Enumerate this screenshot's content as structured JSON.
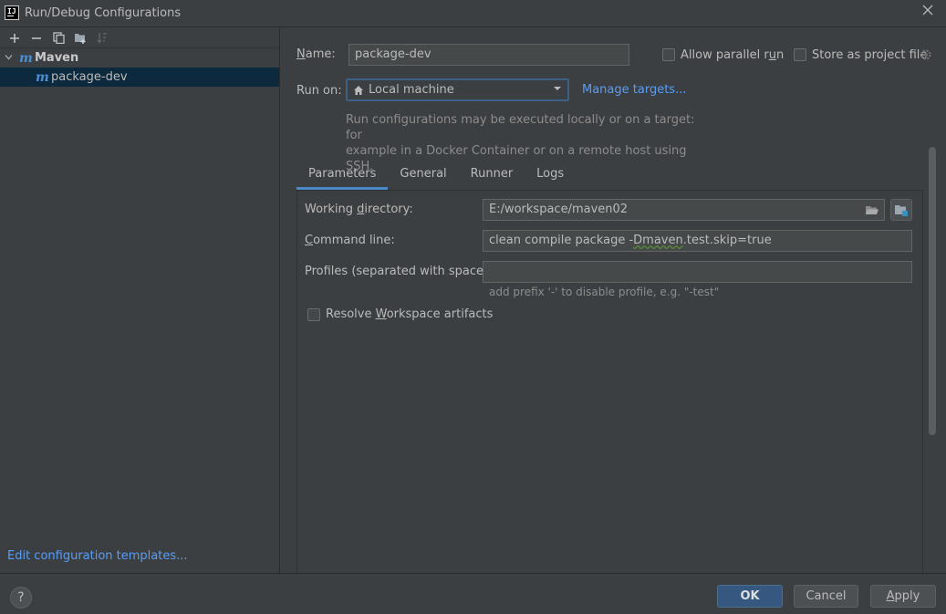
{
  "window": {
    "title": "Run/Debug Configurations",
    "app_icon_text": "IJ"
  },
  "toolbar": {
    "add": "+",
    "remove": "−"
  },
  "tree": {
    "group_label": "Maven",
    "group_icon": "m",
    "items": [
      {
        "label": "package-dev",
        "icon": "m"
      }
    ]
  },
  "left_footer": {
    "edit_templates": "Edit configuration templates..."
  },
  "config": {
    "name_label_u": "N",
    "name_label_rest": "ame:",
    "name_value": "package-dev",
    "allow_parallel_a": "Allow parallel r",
    "allow_parallel_u": "u",
    "allow_parallel_b": "n",
    "store_project_file": "Store as project file",
    "run_on_label": "Run on:",
    "run_on_value": "Local machine",
    "manage_targets": "Manage targets...",
    "run_on_desc_1": "Run configurations may be executed locally or on a target: for",
    "run_on_desc_2": "example in a Docker Container or on a remote host using SSH."
  },
  "tabs": [
    "Parameters",
    "General",
    "Runner",
    "Logs"
  ],
  "parameters": {
    "working_dir_a": "Working ",
    "working_dir_u": "d",
    "working_dir_b": "irectory:",
    "working_dir_value": "E:/workspace/maven02",
    "command_line_u": "C",
    "command_line_rest": "ommand line:",
    "command_line_a": "clean compile package -",
    "command_line_typo": "Dmaven",
    "command_line_b": ".test.skip=true",
    "profiles_label": "Profiles (separated with space):",
    "profiles_value": "",
    "profiles_hint": "add prefix '-' to disable profile, e.g. \"-test\"",
    "resolve_a": "Resolve ",
    "resolve_u": "W",
    "resolve_b": "orkspace artifacts"
  },
  "footer": {
    "help": "?",
    "ok": "OK",
    "cancel": "Cancel",
    "apply_u": "A",
    "apply_rest": "pply"
  },
  "icons": {
    "close": "close-icon",
    "add": "plus-icon",
    "remove": "minus-icon",
    "copy": "copy-icon",
    "folder": "new-folder-icon",
    "sort": "sort-icon",
    "gear": "gear-icon",
    "home": "home-icon",
    "browse": "folder-open-icon",
    "macro": "insert-macro-icon"
  },
  "colors": {
    "accent": "#589df6",
    "selection": "#0d293e",
    "primary_button": "#365880",
    "maven_icon": "#4a8fd4"
  }
}
